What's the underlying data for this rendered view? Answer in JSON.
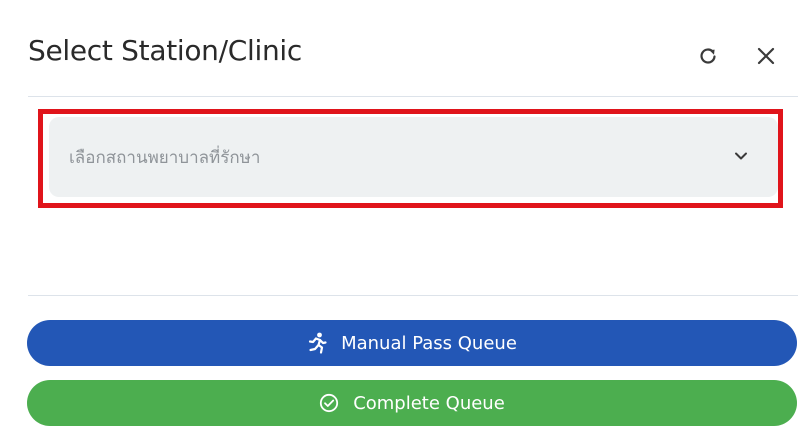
{
  "header": {
    "title": "Select Station/Clinic",
    "refresh_icon": "refresh-icon",
    "close_icon": "close-icon"
  },
  "station_select": {
    "placeholder": "เลือกสถานพยาบาลที่รักษา",
    "icon": "chevron-down-icon"
  },
  "actions": {
    "manual_pass_label": "Manual Pass Queue",
    "manual_pass_icon": "running-person-icon",
    "complete_label": "Complete Queue",
    "complete_icon": "check-circle-icon"
  },
  "colors": {
    "primary": "#2357b6",
    "success": "#4cae4f",
    "highlight": "#e0141b",
    "select_bg": "#eef1f2"
  }
}
